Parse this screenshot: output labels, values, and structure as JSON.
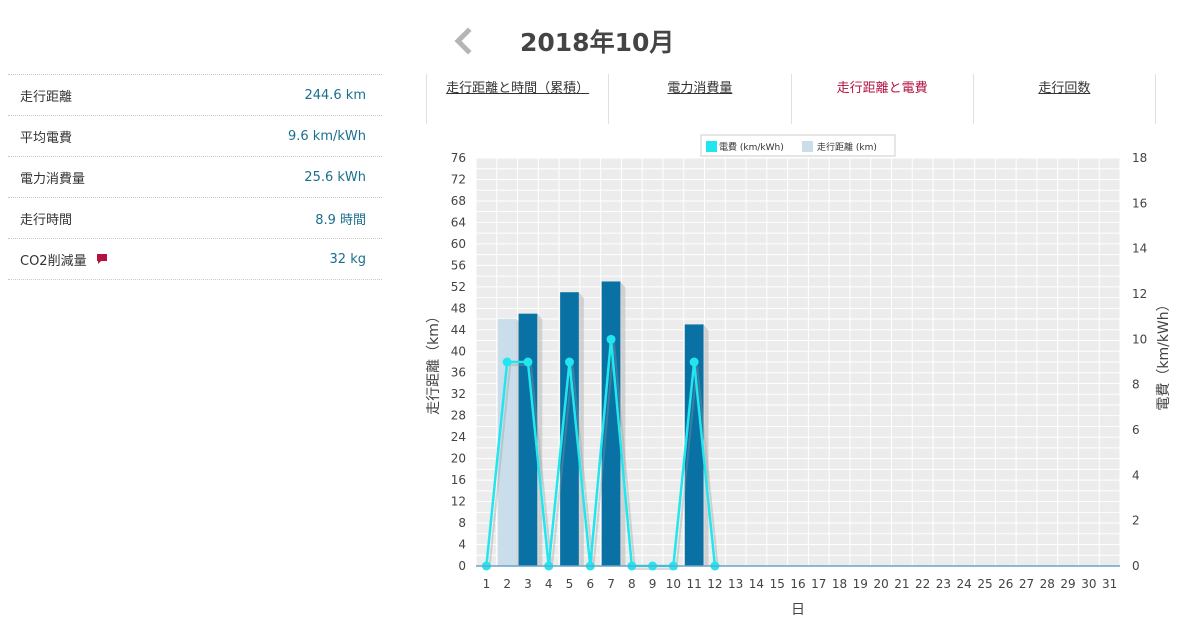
{
  "header": {
    "month": "2018年10月",
    "prev_icon": "chevron-left-icon"
  },
  "summary": [
    {
      "label": "走行距離",
      "value": "244.6 km"
    },
    {
      "label": "平均電費",
      "value": "9.6 km/kWh"
    },
    {
      "label": "電力消費量",
      "value": "25.6 kWh"
    },
    {
      "label": "走行時間",
      "value": "8.9 時間"
    },
    {
      "label": "CO2削減量",
      "value": "32 kg",
      "icon": "comment-icon"
    }
  ],
  "tabs": [
    {
      "label": "走行距離と時間（累積）",
      "active": false
    },
    {
      "label": "電力消費量",
      "active": false
    },
    {
      "label": "走行距離と電費",
      "active": true
    },
    {
      "label": "走行回数",
      "active": false
    }
  ],
  "colors": {
    "accent": "#b4123f",
    "value_text": "#1a6f8f",
    "bar": "#0a71a5",
    "bar_light": "#c9deea",
    "line": "#22e6ee",
    "plot_bg": "#ececec"
  },
  "chart_data": {
    "type": "bar",
    "xlabel": "日",
    "ylabel_left": "走行距離（km）",
    "ylabel_right": "電費（km/kWh）",
    "legend": [
      "電費 (km/kWh)",
      "走行距離 (km)"
    ],
    "legend_position": "top-center",
    "grid": true,
    "x": [
      1,
      2,
      3,
      4,
      5,
      6,
      7,
      8,
      9,
      10,
      11,
      12,
      13,
      14,
      15,
      16,
      17,
      18,
      19,
      20,
      21,
      22,
      23,
      24,
      25,
      26,
      27,
      28,
      29,
      30,
      31
    ],
    "ylim_left": [
      0,
      76
    ],
    "ylim_right": [
      0,
      18
    ],
    "yticks_left": [
      0,
      4,
      8,
      12,
      16,
      20,
      24,
      28,
      32,
      36,
      40,
      44,
      48,
      52,
      56,
      60,
      64,
      68,
      72,
      76
    ],
    "yticks_right": [
      0,
      2,
      4,
      6,
      8,
      10,
      12,
      14,
      16,
      18
    ],
    "series": [
      {
        "name": "走行距離 (km)",
        "axis": "left",
        "type": "bar",
        "values": [
          0,
          46,
          47,
          0,
          51,
          0,
          53,
          0,
          0,
          0,
          45,
          0,
          0,
          0,
          0,
          0,
          0,
          0,
          0,
          0,
          0,
          0,
          0,
          0,
          0,
          0,
          0,
          0,
          0,
          0,
          0
        ],
        "highlight_days": [
          2
        ]
      },
      {
        "name": "電費 (km/kWh)",
        "axis": "right",
        "type": "line",
        "values": [
          0,
          9,
          9,
          0,
          9,
          0,
          10,
          0,
          0,
          0,
          9,
          0,
          null,
          null,
          null,
          null,
          null,
          null,
          null,
          null,
          null,
          null,
          null,
          null,
          null,
          null,
          null,
          null,
          null,
          null,
          null
        ]
      }
    ]
  }
}
